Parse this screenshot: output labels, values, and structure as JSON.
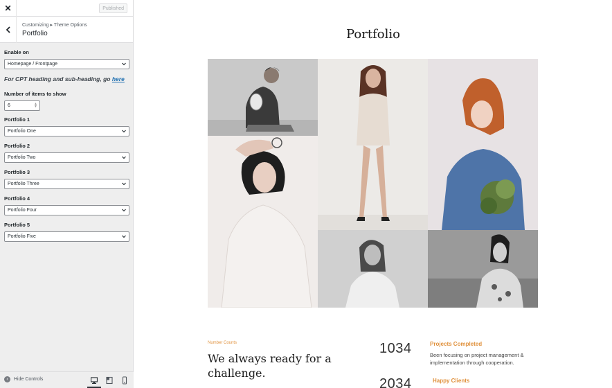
{
  "sidebar": {
    "close_label": "✕",
    "published_label": "Published",
    "breadcrumb": "Customizing ▸ Theme Options",
    "section_title": "Portfolio",
    "enable_on": {
      "label": "Enable on",
      "value": "Homepage / Frontpage"
    },
    "cpt_note": {
      "text": "For CPT heading and sub-heading, go",
      "link": "here"
    },
    "items_to_show": {
      "label": "Number of items to show",
      "value": "6"
    },
    "portfolios": [
      {
        "label": "Portfolio 1",
        "value": "Portfolio One"
      },
      {
        "label": "Portfolio 2",
        "value": "Portfolio Two"
      },
      {
        "label": "Portfolio 3",
        "value": "Portfolio Three"
      },
      {
        "label": "Portfolio 4",
        "value": "Portfolio Four"
      },
      {
        "label": "Portfolio 5",
        "value": "Portfolio Five"
      }
    ],
    "footer": {
      "hide_controls": "Hide Controls",
      "devices": [
        "desktop-icon",
        "tablet-icon",
        "mobile-icon"
      ],
      "active_device": "desktop"
    }
  },
  "preview": {
    "title": "Portfolio",
    "number_counts": {
      "kicker": "Number Counts",
      "heading": "We always ready for a challenge.",
      "stats": [
        {
          "number": "1034",
          "title": "Projects Completed",
          "desc": "Been focusing on project management & implementation through cooperation."
        },
        {
          "number": "2034",
          "title": "Happy Clients",
          "desc": ""
        }
      ]
    }
  },
  "colors": {
    "accent": "#e0913c",
    "link": "#2271b1",
    "sidebar_bg": "#eeeeee"
  }
}
